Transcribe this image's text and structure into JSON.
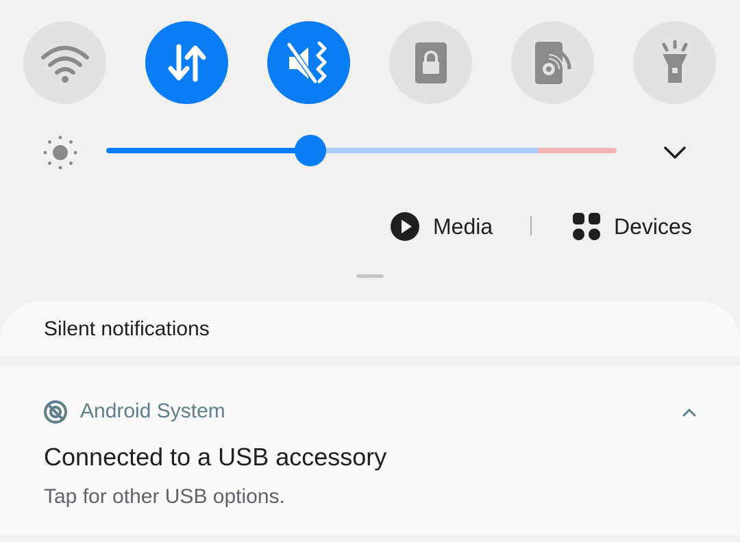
{
  "quick_tiles": [
    {
      "name": "wifi",
      "icon": "wifi-icon",
      "active": false
    },
    {
      "name": "mobile-data",
      "icon": "data-transfer-icon",
      "active": true
    },
    {
      "name": "mute",
      "icon": "sound-mute-icon",
      "active": true
    },
    {
      "name": "screen-lock",
      "icon": "lock-icon",
      "active": false
    },
    {
      "name": "cast",
      "icon": "cast-icon",
      "active": false
    },
    {
      "name": "flashlight",
      "icon": "flashlight-icon",
      "active": false
    }
  ],
  "brightness": {
    "icon": "brightness-icon",
    "level": 0.4
  },
  "controls": {
    "media_label": "Media",
    "devices_label": "Devices"
  },
  "notifications": {
    "section_title": "Silent notifications",
    "items": [
      {
        "app_name": "Android System",
        "app_icon": "android-system-icon",
        "title": "Connected to a USB accessory",
        "body": "Tap for other USB options."
      }
    ]
  },
  "colors": {
    "accent": "#0a7df5",
    "tile_off": "#e2e2e2",
    "icon_off": "#8a8a8a",
    "app_name": "#607d8b"
  }
}
